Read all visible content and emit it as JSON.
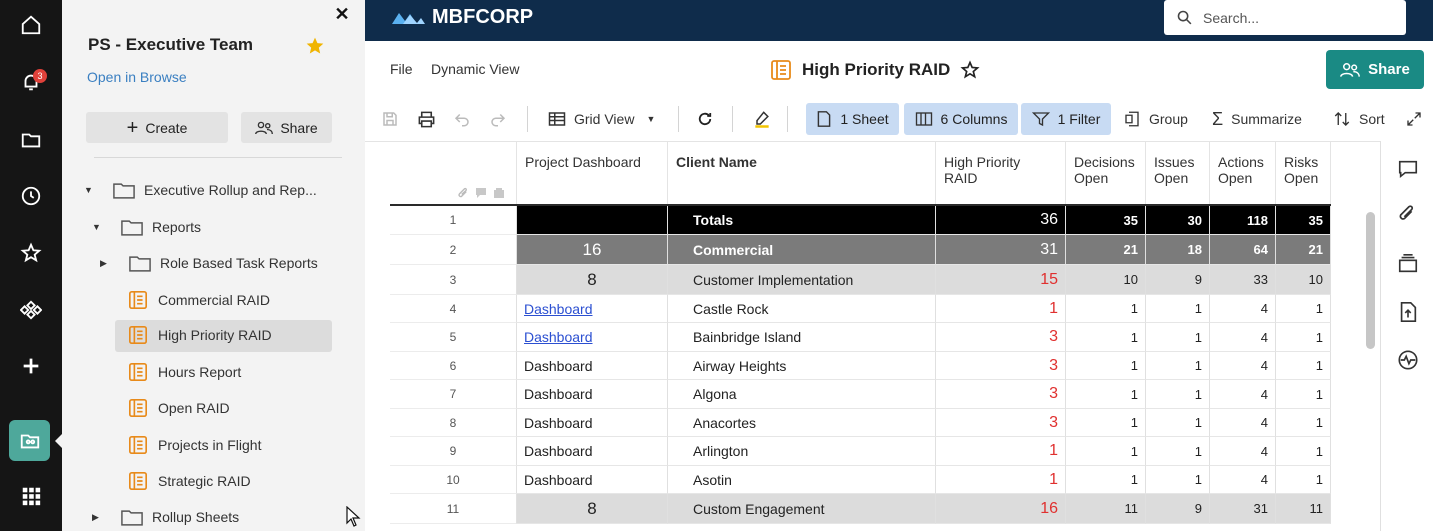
{
  "rail": {
    "notifications_badge": "3"
  },
  "panel": {
    "title": "PS - Executive Team",
    "open_in_browse": "Open in Browse",
    "create_label": "Create",
    "share_label": "Share",
    "tree": [
      {
        "label": "Executive Rollup and Rep...",
        "type": "folder",
        "level": 0,
        "toggle": "▼"
      },
      {
        "label": "Reports",
        "type": "folder",
        "level": 1,
        "toggle": "▼"
      },
      {
        "label": "Role Based Task Reports",
        "type": "folder",
        "level": 2,
        "toggle": "▶"
      },
      {
        "label": "Commercial RAID",
        "type": "report",
        "level": 2
      },
      {
        "label": "High Priority RAID",
        "type": "report",
        "level": 2,
        "selected": true
      },
      {
        "label": "Hours Report",
        "type": "report",
        "level": 2
      },
      {
        "label": "Open RAID",
        "type": "report",
        "level": 2
      },
      {
        "label": "Projects in Flight",
        "type": "report",
        "level": 2
      },
      {
        "label": "Strategic RAID",
        "type": "report",
        "level": 2
      },
      {
        "label": "Rollup Sheets",
        "type": "folder",
        "level": 1,
        "toggle": "▶"
      }
    ]
  },
  "topbar": {
    "logo_text": "MBFCORP",
    "search_placeholder": "Search..."
  },
  "sheet": {
    "menu_file": "File",
    "menu_dynamic_view": "Dynamic View",
    "title": "High Priority RAID",
    "share_label": "Share"
  },
  "toolbar": {
    "grid_view": "Grid View",
    "sheet_pill": "1 Sheet",
    "columns_pill": "6 Columns",
    "filter_pill": "1 Filter",
    "group": "Group",
    "summarize": "Summarize",
    "sort": "Sort"
  },
  "grid": {
    "columns": [
      "Project Dashboard",
      "Client Name",
      "High Priority RAID",
      "Decisions Open",
      "Issues Open",
      "Actions Open",
      "Risks Open"
    ],
    "column_lines": [
      [
        "Project Dashboard"
      ],
      [
        "Client Name"
      ],
      [
        "High Priority RAID"
      ],
      [
        "Decisions",
        "Open"
      ],
      [
        "Issues",
        "Open"
      ],
      [
        "Actions",
        "Open"
      ],
      [
        "Risks",
        "Open"
      ]
    ],
    "rows": [
      {
        "n": "1",
        "style": "black",
        "dash": "",
        "client": "Totals",
        "hp": "36",
        "d": "35",
        "i": "30",
        "a": "118",
        "r": "35"
      },
      {
        "n": "2",
        "style": "darkgray",
        "dash": "16",
        "client": "Commercial",
        "hp": "31",
        "d": "21",
        "i": "18",
        "a": "64",
        "r": "21"
      },
      {
        "n": "3",
        "style": "lightgray",
        "dash": "8",
        "client": "Customer Implementation",
        "hp": "15",
        "d": "10",
        "i": "9",
        "a": "33",
        "r": "10"
      },
      {
        "n": "4",
        "style": "link",
        "dash": "Dashboard",
        "client": "Castle Rock",
        "hp": "1",
        "d": "1",
        "i": "1",
        "a": "4",
        "r": "1"
      },
      {
        "n": "5",
        "style": "link",
        "dash": "Dashboard",
        "client": "Bainbridge Island",
        "hp": "3",
        "d": "1",
        "i": "1",
        "a": "4",
        "r": "1"
      },
      {
        "n": "6",
        "style": "plain",
        "dash": "Dashboard",
        "client": "Airway Heights",
        "hp": "3",
        "d": "1",
        "i": "1",
        "a": "4",
        "r": "1"
      },
      {
        "n": "7",
        "style": "plain",
        "dash": "Dashboard",
        "client": "Algona",
        "hp": "3",
        "d": "1",
        "i": "1",
        "a": "4",
        "r": "1"
      },
      {
        "n": "8",
        "style": "plain",
        "dash": "Dashboard",
        "client": "Anacortes",
        "hp": "3",
        "d": "1",
        "i": "1",
        "a": "4",
        "r": "1"
      },
      {
        "n": "9",
        "style": "plain",
        "dash": "Dashboard",
        "client": "Arlington",
        "hp": "1",
        "d": "1",
        "i": "1",
        "a": "4",
        "r": "1"
      },
      {
        "n": "10",
        "style": "plain",
        "dash": "Dashboard",
        "client": "Asotin",
        "hp": "1",
        "d": "1",
        "i": "1",
        "a": "4",
        "r": "1"
      },
      {
        "n": "11",
        "style": "lightgray",
        "dash": "8",
        "client": "Custom Engagement",
        "hp": "16",
        "d": "11",
        "i": "9",
        "a": "31",
        "r": "11"
      }
    ]
  },
  "colors": {
    "topbar": "#0f2c4b",
    "accent": "#1a8a84",
    "high_priority_red": "#e0302f",
    "pill": "#c8dbf3"
  }
}
